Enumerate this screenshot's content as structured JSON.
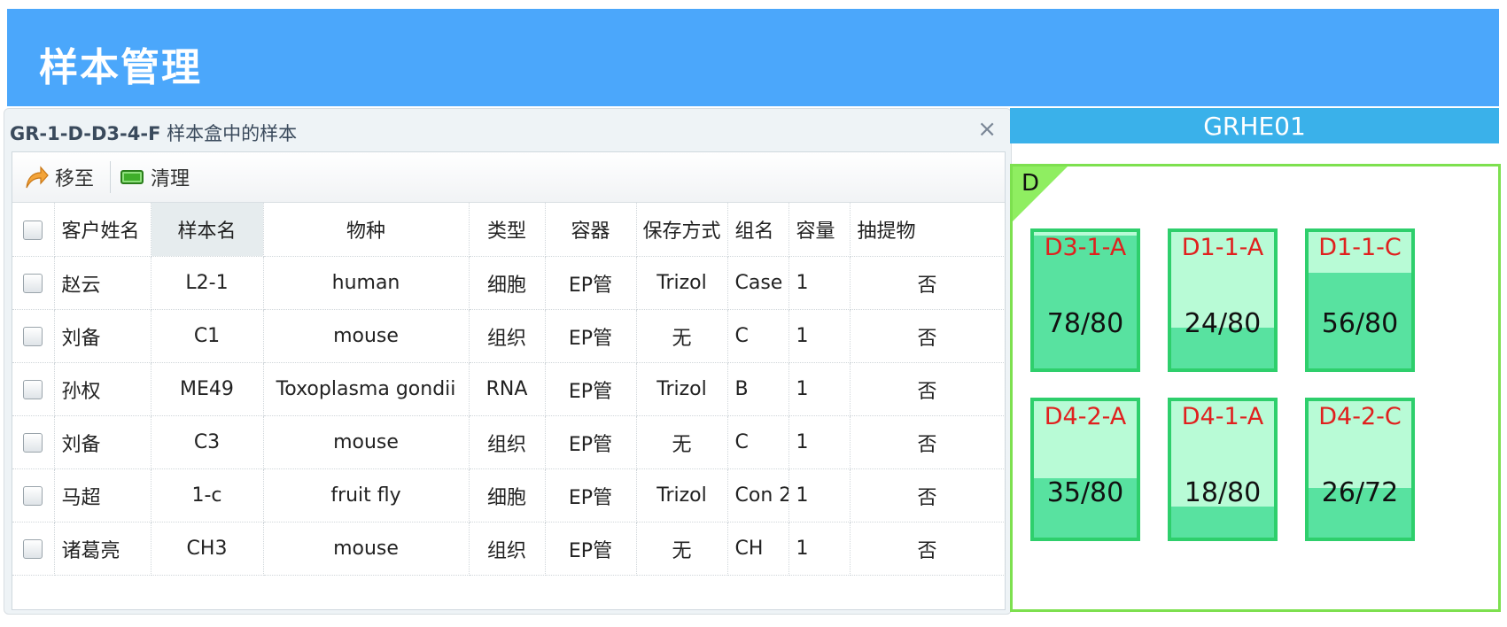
{
  "header": {
    "title": "样本管理"
  },
  "dialog": {
    "box_id": "GR-1-D-D3-4-F",
    "title_suffix": " 样本盒中的样本",
    "close": "×",
    "toolbar": {
      "move_label": "移至",
      "clean_label": "清理"
    },
    "columns": [
      "客户姓名",
      "样本名",
      "物种",
      "类型",
      "容器",
      "保存方式",
      "组名",
      "容量",
      "抽提物"
    ],
    "rows": [
      [
        "赵云",
        "L2-1",
        "human",
        "细胞",
        "EP管",
        "Trizol",
        "Case",
        "1",
        "否"
      ],
      [
        "刘备",
        "C1",
        "mouse",
        "组织",
        "EP管",
        "无",
        "C",
        "1",
        "否"
      ],
      [
        "孙权",
        "ME49",
        "Toxoplasma gondii",
        "RNA",
        "EP管",
        "Trizol",
        "B",
        "1",
        "否"
      ],
      [
        "刘备",
        "C3",
        "mouse",
        "组织",
        "EP管",
        "无",
        "C",
        "1",
        "否"
      ],
      [
        "马超",
        "1-c",
        "fruit fly",
        "细胞",
        "EP管",
        "Trizol",
        "Con 2",
        "1",
        "否"
      ],
      [
        "诸葛亮",
        "CH3",
        "mouse",
        "组织",
        "EP管",
        "无",
        "CH",
        "1",
        "否"
      ]
    ]
  },
  "panel": {
    "title": "GRHE01",
    "section": "D",
    "boxes": [
      {
        "name": "D3-1-A",
        "count": "78/80",
        "fill": 0.975
      },
      {
        "name": "D1-1-A",
        "count": "24/80",
        "fill": 0.3
      },
      {
        "name": "D1-1-C",
        "count": "56/80",
        "fill": 0.7
      },
      {
        "name": "D4-2-A",
        "count": "35/80",
        "fill": 0.4375
      },
      {
        "name": "D4-1-A",
        "count": "18/80",
        "fill": 0.225
      },
      {
        "name": "D4-2-C",
        "count": "26/72",
        "fill": 0.361
      }
    ]
  },
  "colors": {
    "header_bg": "#4ba7fb",
    "panel_title_bg": "#3ab1ea",
    "box_border": "#2ecf6c",
    "box_fill": "#58e2a0",
    "box_empty": "#b8fbd6",
    "box_label": "#e0201e",
    "frame_border": "#7de04f"
  }
}
